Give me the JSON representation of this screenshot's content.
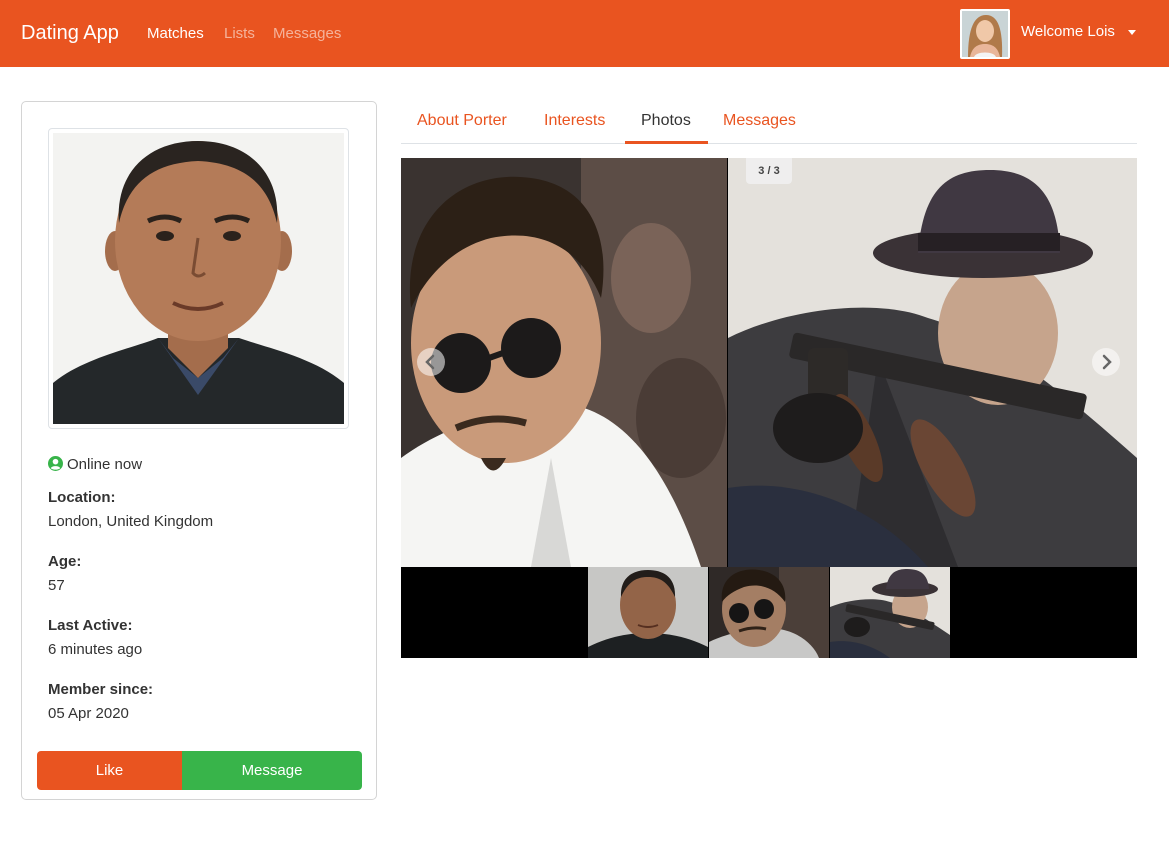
{
  "navbar": {
    "brand": "Dating App",
    "links": [
      {
        "label": "Matches",
        "active": true
      },
      {
        "label": "Lists",
        "active": false
      },
      {
        "label": "Messages",
        "active": false
      }
    ],
    "welcome": "Welcome Lois",
    "color": "#e95420"
  },
  "profile": {
    "status": "Online now",
    "status_icon": "user-circle-icon",
    "fields": [
      {
        "label": "Location:",
        "value": "London, United Kingdom"
      },
      {
        "label": "Age:",
        "value": "57"
      },
      {
        "label": "Last Active:",
        "value": "6 minutes ago"
      },
      {
        "label": "Member since:",
        "value": "05 Apr 2020"
      }
    ],
    "buttons": {
      "like": "Like",
      "message": "Message"
    },
    "colors": {
      "like": "#e95420",
      "message": "#38b44a",
      "online": "#38b44a"
    }
  },
  "tabs": [
    {
      "label": "About Porter",
      "active": false
    },
    {
      "label": "Interests",
      "active": false
    },
    {
      "label": "Photos",
      "active": true
    },
    {
      "label": "Messages",
      "active": false
    }
  ],
  "gallery": {
    "counter": "3 / 3",
    "photo_count": 3,
    "current": 3
  }
}
